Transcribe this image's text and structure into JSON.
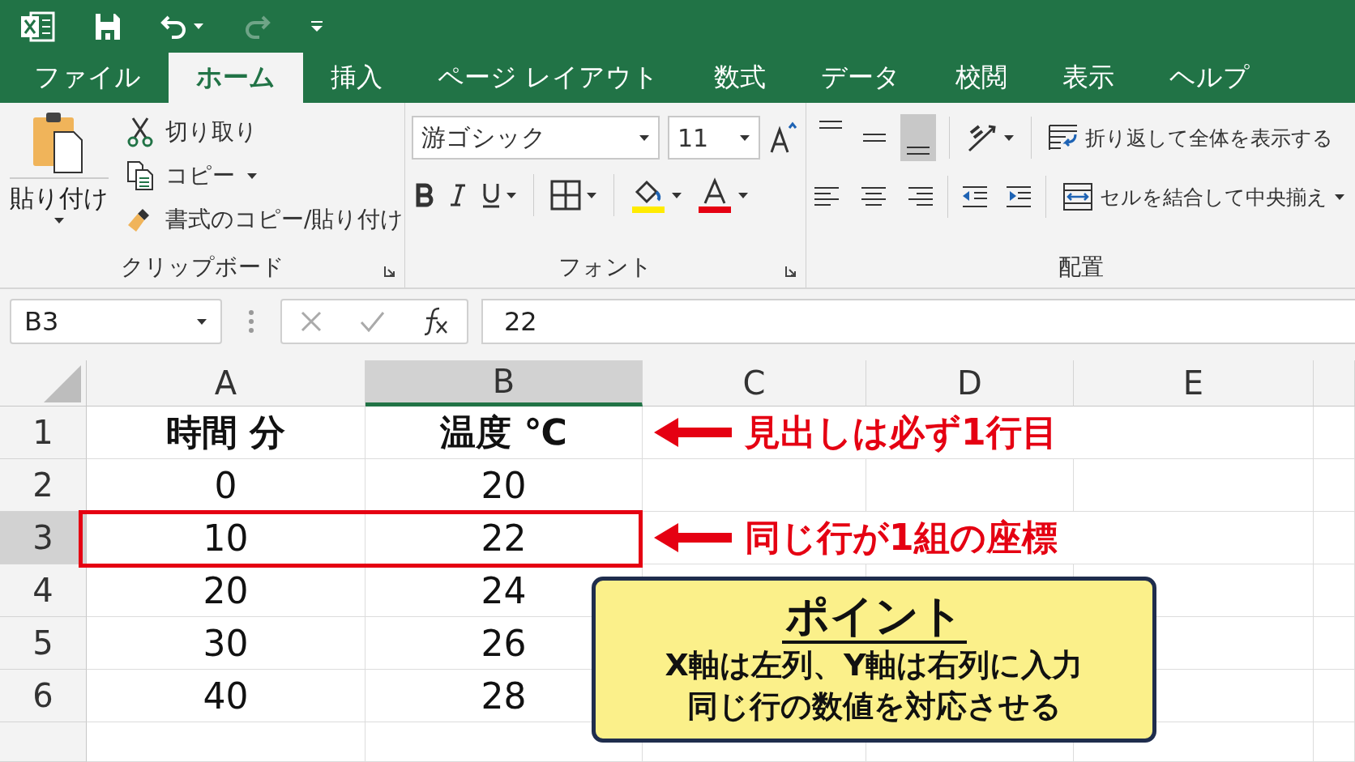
{
  "quick_access": {
    "redo": {
      "disabled": true
    }
  },
  "tabs": [
    {
      "label": "ファイル",
      "selected": false
    },
    {
      "label": "ホーム",
      "selected": true
    },
    {
      "label": "挿入",
      "selected": false
    },
    {
      "label": "ページ レイアウト",
      "selected": false
    },
    {
      "label": "数式",
      "selected": false
    },
    {
      "label": "データ",
      "selected": false
    },
    {
      "label": "校閲",
      "selected": false
    },
    {
      "label": "表示",
      "selected": false
    },
    {
      "label": "ヘルプ",
      "selected": false
    }
  ],
  "clipboard": {
    "paste": "貼り付け",
    "cut": "切り取り",
    "copy": "コピー",
    "format_painter": "書式のコピー/貼り付け",
    "label": "クリップボード"
  },
  "font": {
    "name": "游ゴシック",
    "size": "11",
    "label": "フォント"
  },
  "alignment": {
    "vertical_align_buttons": [
      {
        "selected": false
      },
      {
        "selected": false
      },
      {
        "selected": true
      }
    ],
    "wrap_text": "折り返して全体を表示する",
    "merge_center": "セルを結合して中央揃え",
    "label": "配置"
  },
  "formula_bar": {
    "name_box": "B3",
    "formula": "22"
  },
  "sheet": {
    "columns": [
      {
        "label": "A",
        "selected": false
      },
      {
        "label": "B",
        "selected": true
      },
      {
        "label": "C",
        "selected": false
      },
      {
        "label": "D",
        "selected": false
      },
      {
        "label": "E",
        "selected": false
      }
    ],
    "rows": [
      {
        "number": "1",
        "selected": false,
        "kind": "header",
        "cells": [
          "時間 分",
          "温度 ℃"
        ],
        "note": "見出しは必ず1行目"
      },
      {
        "number": "2",
        "selected": false,
        "kind": "data",
        "cells": [
          "0",
          "20"
        ]
      },
      {
        "number": "3",
        "selected": true,
        "kind": "data",
        "highlighted": true,
        "cells": [
          "10",
          "22"
        ],
        "note": "同じ行が1組の座標"
      },
      {
        "number": "4",
        "selected": false,
        "kind": "data",
        "cells": [
          "20",
          "24"
        ]
      },
      {
        "number": "5",
        "selected": false,
        "kind": "data",
        "cells": [
          "30",
          "26"
        ]
      },
      {
        "number": "6",
        "selected": false,
        "kind": "data",
        "cells": [
          "40",
          "28"
        ]
      }
    ]
  },
  "callout": {
    "title": "ポイント",
    "lines": [
      "X軸は左列、Y軸は右列に入力",
      "同じ行の数値を対応させる"
    ]
  }
}
